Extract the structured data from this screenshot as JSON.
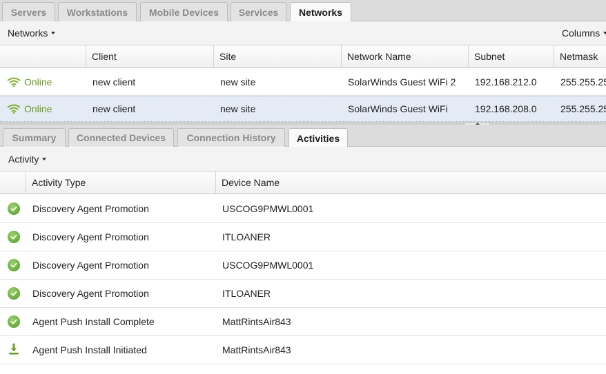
{
  "top_tabs": [
    "Servers",
    "Workstations",
    "Mobile Devices",
    "Services",
    "Networks"
  ],
  "networks_toolbar": {
    "menu_label": "Networks",
    "columns_label": "Columns"
  },
  "networks_grid": {
    "columns": [
      "",
      "Client",
      "Site",
      "Network Name",
      "Subnet",
      "Netmask"
    ],
    "rows": [
      {
        "status": "Online",
        "client": "new client",
        "site": "new site",
        "network": "SolarWinds Guest WiFi 2",
        "subnet": "192.168.212.0",
        "netmask": "255.255.25"
      },
      {
        "status": "Online",
        "client": "new client",
        "site": "new site",
        "network": "SolarWinds Guest WiFi",
        "subnet": "192.168.208.0",
        "netmask": "255.255.25"
      }
    ]
  },
  "detail_tabs": [
    "Summary",
    "Connected Devices",
    "Connection History",
    "Activities"
  ],
  "activity_toolbar": {
    "menu_label": "Activity"
  },
  "activity_grid": {
    "columns": [
      "",
      "Activity Type",
      "Device Name"
    ],
    "rows": [
      {
        "icon": "check-circle-icon",
        "type": "Discovery Agent Promotion",
        "device": "USCOG9PMWL0001"
      },
      {
        "icon": "check-circle-icon",
        "type": "Discovery Agent Promotion",
        "device": "ITLOANER"
      },
      {
        "icon": "check-circle-icon",
        "type": "Discovery Agent Promotion",
        "device": "USCOG9PMWL0001"
      },
      {
        "icon": "check-circle-icon",
        "type": "Discovery Agent Promotion",
        "device": "ITLOANER"
      },
      {
        "icon": "check-circle-icon",
        "type": "Agent Push Install Complete",
        "device": "MattRintsAir843"
      },
      {
        "icon": "download-icon",
        "type": "Agent Push Install Initiated",
        "device": "MattRintsAir843"
      }
    ]
  },
  "colors": {
    "online_green": "#6a9a1c",
    "selected_row": "#e4ebf5",
    "tab_bar": "#dcdcdc"
  }
}
